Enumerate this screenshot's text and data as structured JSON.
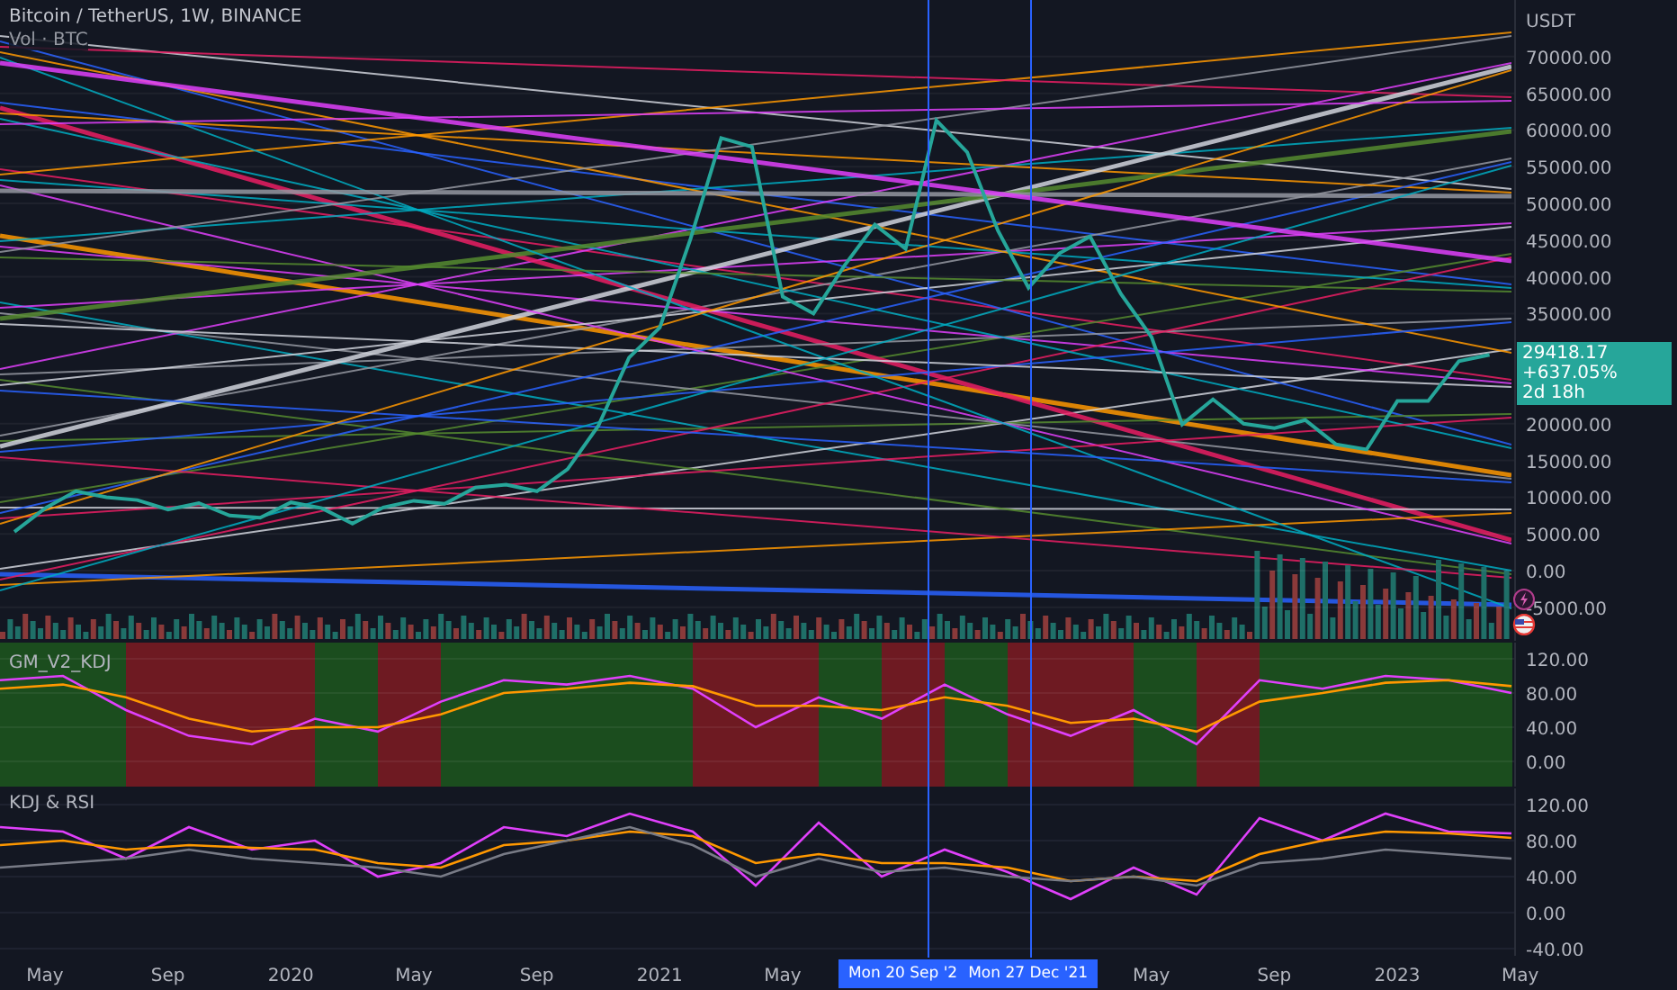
{
  "main_chart": {
    "volume_label": "Vol · BTC",
    "currency": "USDT",
    "last_price": "29418.17",
    "change": "+637.05%",
    "countdown": "2d 18h",
    "chart_data": {
      "type": "line",
      "title": "Bitcoin / TetherUS, 1W, BINANCE",
      "grid": true,
      "series": [
        {
          "color": "#26a69a",
          "values": [
            5300,
            8500,
            10800,
            10000,
            9600,
            8300,
            9200,
            7500,
            7200,
            9300,
            8500,
            6400,
            8600,
            9500,
            9100,
            11300,
            11700,
            10800,
            13800,
            19700,
            29000,
            33100,
            45200,
            58900,
            57700,
            37300,
            35000,
            41500,
            47100,
            43800,
            61300,
            57000,
            46300,
            38500,
            43200,
            45500,
            37700,
            31800,
            19900,
            23300,
            20000,
            19400,
            20500,
            17200,
            16500,
            23100,
            23100,
            28500,
            29400
          ]
        }
      ],
      "ylim": [
        -9560,
        77700
      ],
      "yticks": [
        {
          "value": 70000,
          "label": "70000.00"
        },
        {
          "value": 65000,
          "label": "65000.00"
        },
        {
          "value": 60000,
          "label": "60000.00"
        },
        {
          "value": 55000,
          "label": "55000.00"
        },
        {
          "value": 50000,
          "label": "50000.00"
        },
        {
          "value": 45000,
          "label": "45000.00"
        },
        {
          "value": 40000,
          "label": "40000.00"
        },
        {
          "value": 35000,
          "label": "35000.00"
        },
        {
          "value": 20000,
          "label": "20000.00"
        },
        {
          "value": 15000,
          "label": "15000.00"
        },
        {
          "value": 10000,
          "label": "10000.00"
        },
        {
          "value": 5000,
          "label": "5000.00"
        },
        {
          "value": 0,
          "label": "0.00"
        },
        {
          "value": -5000,
          "label": "-5000.00"
        }
      ]
    }
  },
  "gm_pane": {
    "chart_data": {
      "type": "line",
      "title": "GM_V2_KDJ",
      "grid": true,
      "series": [
        {
          "color": "#e040fb",
          "values": [
            95,
            100,
            60,
            30,
            20,
            50,
            35,
            70,
            95,
            90,
            100,
            85,
            40,
            75,
            50,
            90,
            55,
            30,
            60,
            20,
            95,
            85,
            100,
            95,
            80
          ]
        },
        {
          "color": "#ff9800",
          "values": [
            85,
            90,
            75,
            50,
            35,
            40,
            40,
            55,
            80,
            85,
            92,
            88,
            65,
            65,
            60,
            75,
            65,
            45,
            50,
            35,
            70,
            80,
            92,
            95,
            88
          ]
        }
      ],
      "ylim": [
        -29.5,
        139
      ],
      "yticks": [
        {
          "value": 120,
          "label": "120.00"
        },
        {
          "value": 80,
          "label": "80.00"
        },
        {
          "value": 40,
          "label": "40.00"
        },
        {
          "value": 0,
          "label": "0.00"
        }
      ]
    }
  },
  "kdj_pane": {
    "chart_data": {
      "type": "line",
      "title": "KDJ & RSI",
      "grid": true,
      "series": [
        {
          "color": "#e040fb",
          "values": [
            95,
            90,
            60,
            95,
            70,
            80,
            40,
            55,
            95,
            85,
            110,
            90,
            30,
            100,
            40,
            70,
            45,
            15,
            50,
            20,
            105,
            80,
            110,
            90,
            88
          ]
        },
        {
          "color": "#ff9800",
          "values": [
            75,
            80,
            70,
            75,
            72,
            70,
            55,
            50,
            75,
            80,
            90,
            85,
            55,
            65,
            55,
            55,
            50,
            35,
            40,
            35,
            65,
            80,
            90,
            88,
            83
          ]
        },
        {
          "color": "#787b86",
          "values": [
            50,
            55,
            60,
            70,
            60,
            55,
            50,
            40,
            65,
            80,
            95,
            75,
            40,
            60,
            45,
            50,
            40,
            35,
            40,
            30,
            55,
            60,
            70,
            65,
            60
          ]
        }
      ],
      "ylim": [
        -50,
        138
      ],
      "yticks": [
        {
          "value": 120,
          "label": "120.00"
        },
        {
          "value": 80,
          "label": "80.00"
        },
        {
          "value": 40,
          "label": "40.00"
        },
        {
          "value": 0,
          "label": "0.00"
        },
        {
          "value": -40,
          "label": "-40.00"
        }
      ]
    }
  },
  "time_axis": [
    "May",
    "Sep",
    "2020",
    "May",
    "Sep",
    "2021",
    "May",
    "May",
    "Sep",
    "2023",
    "May"
  ],
  "crosshair_labels": [
    "Mon 20 Sep '2",
    "Mon 27 Dec '21"
  ]
}
